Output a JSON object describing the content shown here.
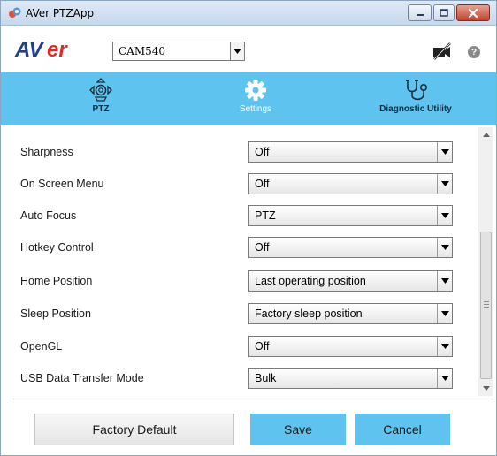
{
  "window": {
    "title": "AVer PTZApp"
  },
  "toolbar": {
    "logo_text": "AVer",
    "camera_selected": "CAM540",
    "help_glyph": "?"
  },
  "nav": {
    "tabs": [
      {
        "label": "PTZ",
        "icon": "ptz-camera-icon"
      },
      {
        "label": "Settings",
        "icon": "gear-icon"
      },
      {
        "label": "Diagnostic Utility",
        "icon": "stethoscope-icon"
      }
    ],
    "active_index": 1
  },
  "settings": {
    "rows": [
      {
        "label": "Sharpness",
        "value": "Off"
      },
      {
        "label": "On Screen Menu",
        "value": "Off"
      },
      {
        "label": "Auto Focus",
        "value": "PTZ"
      },
      {
        "label": "Hotkey Control",
        "value": "Off"
      },
      {
        "label": "Home Position",
        "value": "Last operating position"
      },
      {
        "label": "Sleep Position",
        "value": "Factory sleep position"
      },
      {
        "label": "OpenGL",
        "value": "Off"
      },
      {
        "label": "USB Data Transfer Mode",
        "value": "Bulk"
      }
    ]
  },
  "actions": {
    "factory_default": "Factory Default",
    "save": "Save",
    "cancel": "Cancel"
  },
  "colors": {
    "accent": "#5ec3ee",
    "logo_blue": "#1f3f8f",
    "logo_red": "#e02a2a"
  }
}
